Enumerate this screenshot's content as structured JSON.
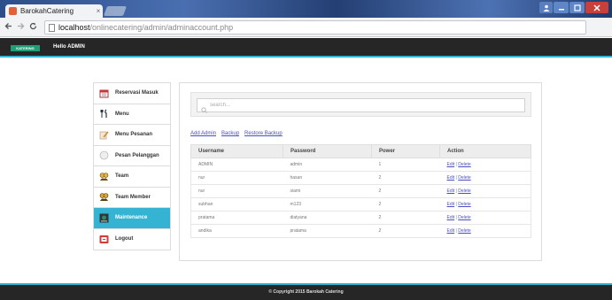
{
  "browser": {
    "tab_title": "BarokahCatering",
    "tab_close": "×",
    "url_host": "localhost",
    "url_path": "/onlinecatering/admin/adminaccount.php"
  },
  "site": {
    "brand_badge": "KATERING",
    "greeting": "Hello ADMIN",
    "accent_color": "#34b3d3"
  },
  "sidebar": {
    "items": [
      {
        "label": "Reservasi Masuk",
        "icon": "calendar-icon"
      },
      {
        "label": "Menu",
        "icon": "fork-knife-icon"
      },
      {
        "label": "Menu Pesanan",
        "icon": "note-pencil-icon"
      },
      {
        "label": "Pesan Pelanggan",
        "icon": "chat-bubble-icon"
      },
      {
        "label": "Team",
        "icon": "team-icon"
      },
      {
        "label": "Team Member",
        "icon": "team-member-icon"
      },
      {
        "label": "Maintenance",
        "icon": "maintenance-icon"
      },
      {
        "label": "Logout",
        "icon": "logout-icon"
      }
    ],
    "active_index": 6
  },
  "search": {
    "placeholder": "search..."
  },
  "links": {
    "add_admin": "Add Admin",
    "backup": "Backup",
    "restore_backup": "Restore Backup"
  },
  "table": {
    "headers": [
      "Username",
      "Password",
      "Power",
      "Action"
    ],
    "rows": [
      {
        "username": "ADMIN",
        "password": "admin",
        "power": "1"
      },
      {
        "username": "nur",
        "password": "hasan",
        "power": "2"
      },
      {
        "username": "nur",
        "password": "siami",
        "power": "2"
      },
      {
        "username": "subhan",
        "password": "m123",
        "power": "2"
      },
      {
        "username": "pratama",
        "password": "diatyana",
        "power": "2"
      },
      {
        "username": "andika",
        "password": "pratama",
        "power": "2"
      }
    ],
    "edit_label": "Edit",
    "separator": "|",
    "delete_label": "Delete"
  },
  "footer": {
    "copyright": "© Copyright 2015 Barokah Catering"
  }
}
